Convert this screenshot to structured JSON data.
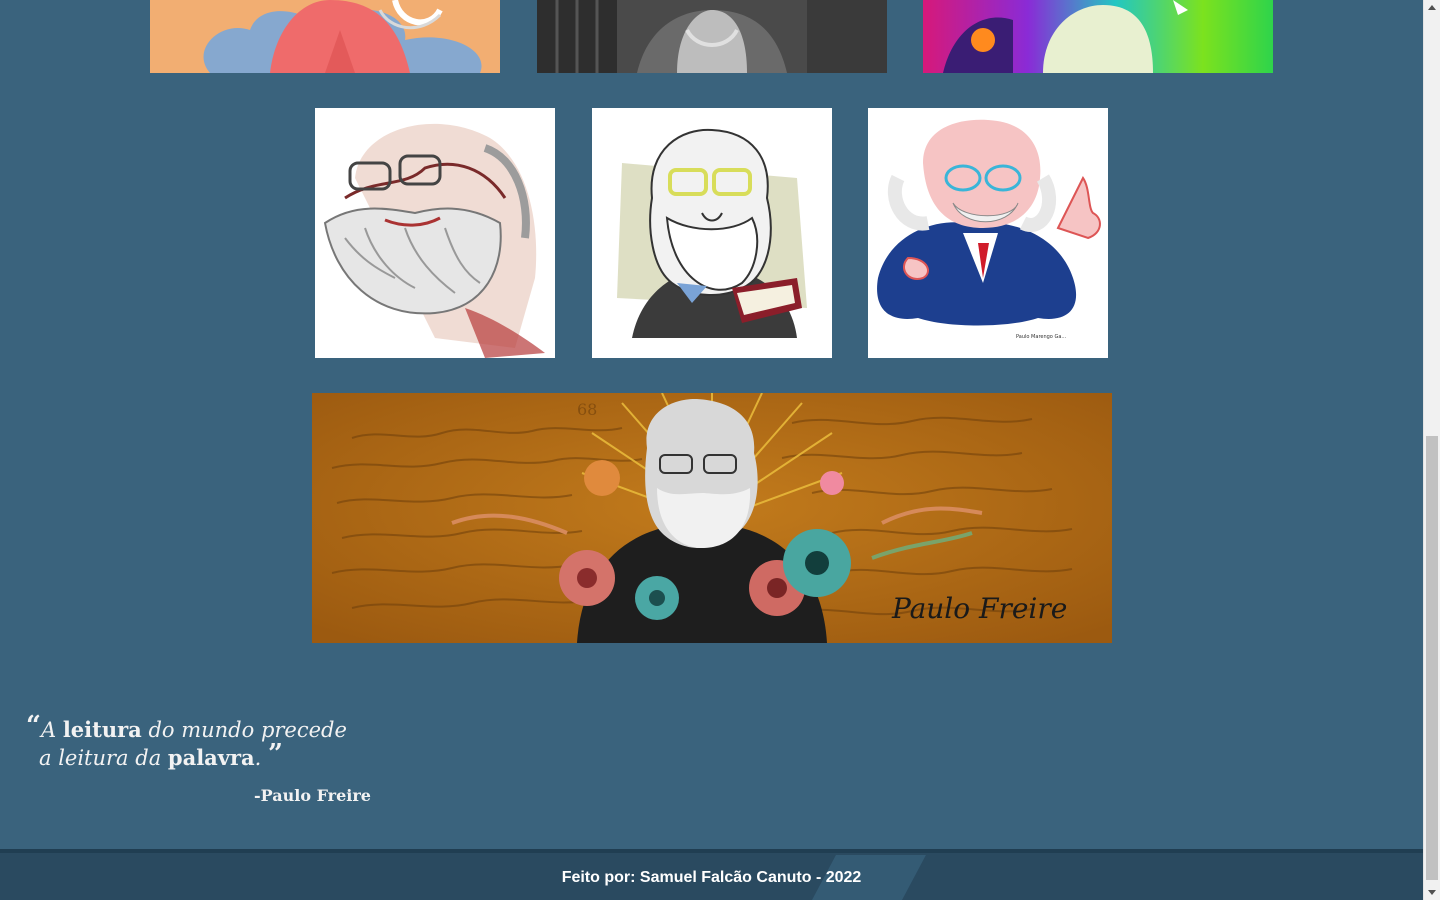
{
  "gallery": {
    "row1": [
      {
        "name": "portrait-illustration-orange"
      },
      {
        "name": "portrait-photo-bw"
      },
      {
        "name": "portrait-illustration-rainbow"
      }
    ],
    "row2": [
      {
        "name": "caricature-sketch"
      },
      {
        "name": "caricature-cartoon-book"
      },
      {
        "name": "caricature-pointing",
        "signature": "Paulo Marengo Ga..."
      }
    ],
    "banner": {
      "name": "banner-flowers-signature",
      "signature": "Paulo Freire",
      "page_number": "68"
    }
  },
  "quote": {
    "open_mark": "“",
    "part1": "A ",
    "bold1": "leitura",
    "part2": " do mundo precede",
    "part3": "a leitura da ",
    "bold2": "palavra",
    "part4": ".",
    "close_mark": "”",
    "author": "-Paulo Freire"
  },
  "footer": {
    "credit": "Feito por: Samuel Falcão Canuto - 2022"
  },
  "colors": {
    "background": "#3a637d",
    "footer": "#2a4a60",
    "banner": "#b06a12"
  }
}
